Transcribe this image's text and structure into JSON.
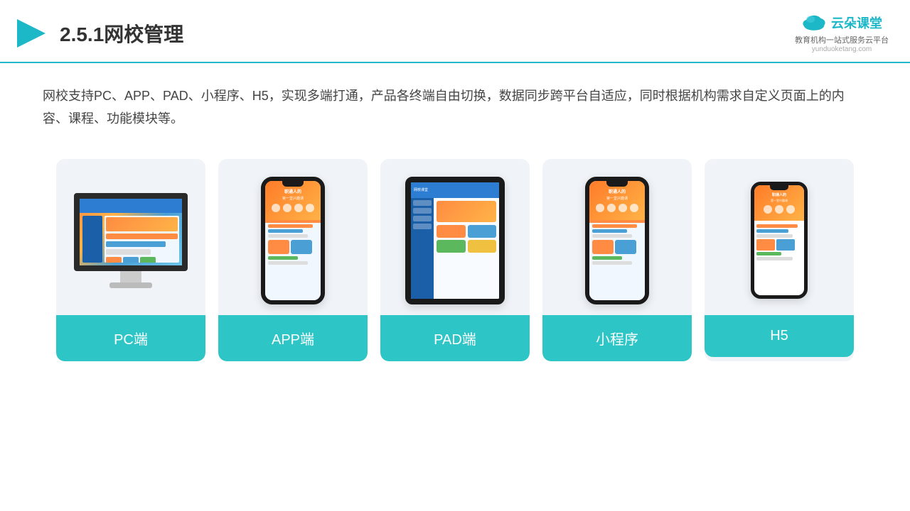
{
  "header": {
    "title": "2.5.1网校管理",
    "logo": {
      "name": "云朵课堂",
      "domain": "yunduoketang.com",
      "tagline": "教育机构一站式服务云平台"
    }
  },
  "description": {
    "text": "网校支持PC、APP、PAD、小程序、H5，实现多端打通，产品各终端自由切换，数据同步跨平台自适应，同时根据机构需求自定义页面上的内容、课程、功能模块等。"
  },
  "cards": [
    {
      "id": "pc",
      "label": "PC端"
    },
    {
      "id": "app",
      "label": "APP端"
    },
    {
      "id": "pad",
      "label": "PAD端"
    },
    {
      "id": "miniprogram",
      "label": "小程序"
    },
    {
      "id": "h5",
      "label": "H5"
    }
  ]
}
